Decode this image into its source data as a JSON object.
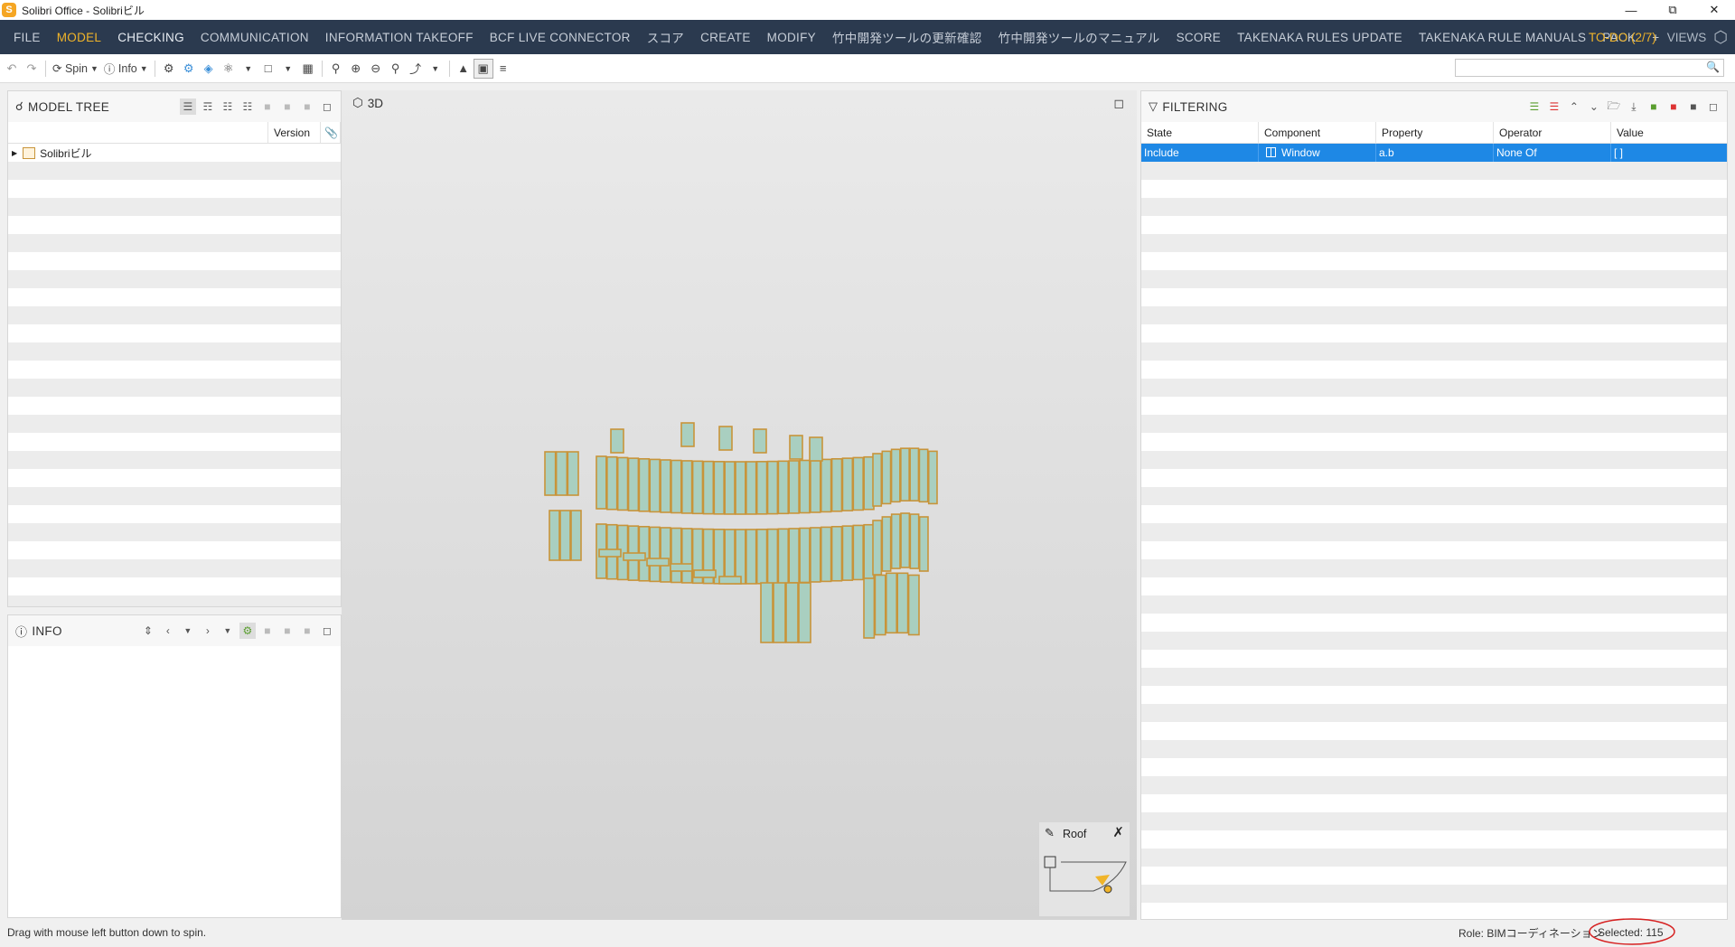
{
  "window": {
    "title": "Solibri Office - Solibriビル",
    "app_icon": "S"
  },
  "menu": {
    "items": [
      "FILE",
      "MODEL",
      "CHECKING",
      "COMMUNICATION",
      "INFORMATION TAKEOFF",
      "BCF LIVE CONNECTOR",
      "スコア",
      "CREATE",
      "MODIFY",
      "竹中開発ツールの更新確認",
      "竹中開発ツールのマニュアル",
      "SCORE",
      "TAKENAKA RULES UPDATE",
      "TAKENAKA RULE MANUALS",
      "PACK",
      "+"
    ],
    "active": "MODEL",
    "todo": "TO-DO (2/7)",
    "views": "VIEWS"
  },
  "toolbar": {
    "spin_label": "Spin",
    "info_label": "Info"
  },
  "model_tree": {
    "title": "MODEL TREE",
    "col_version": "Version",
    "root_item": "Solibriビル"
  },
  "info_panel": {
    "title": "INFO"
  },
  "view3d": {
    "title": "3D"
  },
  "minimap": {
    "label": "Roof"
  },
  "filtering": {
    "title": "FILTERING",
    "columns": [
      "State",
      "Component",
      "Property",
      "Operator",
      "Value"
    ],
    "rows": [
      {
        "state": "Include",
        "component": "Window",
        "property": "a.b",
        "operator": "None Of",
        "value": "[ ]"
      }
    ]
  },
  "status": {
    "hint": "Drag with mouse left button down to spin.",
    "role": "Role: BIMコーディネーション",
    "selected": "Selected: 115"
  },
  "colors": {
    "menubar": "#2b3a4f",
    "accent": "#f0b429",
    "selection": "#1e88e5",
    "window_frame": "#c8943a",
    "window_glass": "#a9cfc0"
  }
}
